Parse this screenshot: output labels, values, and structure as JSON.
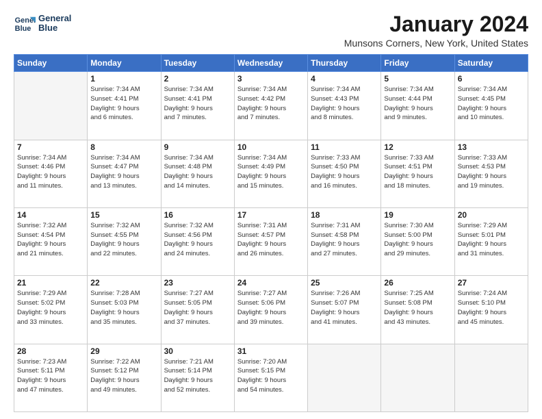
{
  "header": {
    "logo_line1": "General",
    "logo_line2": "Blue",
    "month_title": "January 2024",
    "location": "Munsons Corners, New York, United States"
  },
  "days_of_week": [
    "Sunday",
    "Monday",
    "Tuesday",
    "Wednesday",
    "Thursday",
    "Friday",
    "Saturday"
  ],
  "weeks": [
    [
      {
        "day": "",
        "empty": true
      },
      {
        "day": "1",
        "sunrise": "7:34 AM",
        "sunset": "4:41 PM",
        "daylight": "9 hours and 6 minutes."
      },
      {
        "day": "2",
        "sunrise": "7:34 AM",
        "sunset": "4:41 PM",
        "daylight": "9 hours and 7 minutes."
      },
      {
        "day": "3",
        "sunrise": "7:34 AM",
        "sunset": "4:42 PM",
        "daylight": "9 hours and 7 minutes."
      },
      {
        "day": "4",
        "sunrise": "7:34 AM",
        "sunset": "4:43 PM",
        "daylight": "9 hours and 8 minutes."
      },
      {
        "day": "5",
        "sunrise": "7:34 AM",
        "sunset": "4:44 PM",
        "daylight": "9 hours and 9 minutes."
      },
      {
        "day": "6",
        "sunrise": "7:34 AM",
        "sunset": "4:45 PM",
        "daylight": "9 hours and 10 minutes."
      }
    ],
    [
      {
        "day": "7",
        "sunrise": "7:34 AM",
        "sunset": "4:46 PM",
        "daylight": "9 hours and 11 minutes."
      },
      {
        "day": "8",
        "sunrise": "7:34 AM",
        "sunset": "4:47 PM",
        "daylight": "9 hours and 13 minutes."
      },
      {
        "day": "9",
        "sunrise": "7:34 AM",
        "sunset": "4:48 PM",
        "daylight": "9 hours and 14 minutes."
      },
      {
        "day": "10",
        "sunrise": "7:34 AM",
        "sunset": "4:49 PM",
        "daylight": "9 hours and 15 minutes."
      },
      {
        "day": "11",
        "sunrise": "7:33 AM",
        "sunset": "4:50 PM",
        "daylight": "9 hours and 16 minutes."
      },
      {
        "day": "12",
        "sunrise": "7:33 AM",
        "sunset": "4:51 PM",
        "daylight": "9 hours and 18 minutes."
      },
      {
        "day": "13",
        "sunrise": "7:33 AM",
        "sunset": "4:53 PM",
        "daylight": "9 hours and 19 minutes."
      }
    ],
    [
      {
        "day": "14",
        "sunrise": "7:32 AM",
        "sunset": "4:54 PM",
        "daylight": "9 hours and 21 minutes."
      },
      {
        "day": "15",
        "sunrise": "7:32 AM",
        "sunset": "4:55 PM",
        "daylight": "9 hours and 22 minutes."
      },
      {
        "day": "16",
        "sunrise": "7:32 AM",
        "sunset": "4:56 PM",
        "daylight": "9 hours and 24 minutes."
      },
      {
        "day": "17",
        "sunrise": "7:31 AM",
        "sunset": "4:57 PM",
        "daylight": "9 hours and 26 minutes."
      },
      {
        "day": "18",
        "sunrise": "7:31 AM",
        "sunset": "4:58 PM",
        "daylight": "9 hours and 27 minutes."
      },
      {
        "day": "19",
        "sunrise": "7:30 AM",
        "sunset": "5:00 PM",
        "daylight": "9 hours and 29 minutes."
      },
      {
        "day": "20",
        "sunrise": "7:29 AM",
        "sunset": "5:01 PM",
        "daylight": "9 hours and 31 minutes."
      }
    ],
    [
      {
        "day": "21",
        "sunrise": "7:29 AM",
        "sunset": "5:02 PM",
        "daylight": "9 hours and 33 minutes."
      },
      {
        "day": "22",
        "sunrise": "7:28 AM",
        "sunset": "5:03 PM",
        "daylight": "9 hours and 35 minutes."
      },
      {
        "day": "23",
        "sunrise": "7:27 AM",
        "sunset": "5:05 PM",
        "daylight": "9 hours and 37 minutes."
      },
      {
        "day": "24",
        "sunrise": "7:27 AM",
        "sunset": "5:06 PM",
        "daylight": "9 hours and 39 minutes."
      },
      {
        "day": "25",
        "sunrise": "7:26 AM",
        "sunset": "5:07 PM",
        "daylight": "9 hours and 41 minutes."
      },
      {
        "day": "26",
        "sunrise": "7:25 AM",
        "sunset": "5:08 PM",
        "daylight": "9 hours and 43 minutes."
      },
      {
        "day": "27",
        "sunrise": "7:24 AM",
        "sunset": "5:10 PM",
        "daylight": "9 hours and 45 minutes."
      }
    ],
    [
      {
        "day": "28",
        "sunrise": "7:23 AM",
        "sunset": "5:11 PM",
        "daylight": "9 hours and 47 minutes."
      },
      {
        "day": "29",
        "sunrise": "7:22 AM",
        "sunset": "5:12 PM",
        "daylight": "9 hours and 49 minutes."
      },
      {
        "day": "30",
        "sunrise": "7:21 AM",
        "sunset": "5:14 PM",
        "daylight": "9 hours and 52 minutes."
      },
      {
        "day": "31",
        "sunrise": "7:20 AM",
        "sunset": "5:15 PM",
        "daylight": "9 hours and 54 minutes."
      },
      {
        "day": "",
        "empty": true
      },
      {
        "day": "",
        "empty": true
      },
      {
        "day": "",
        "empty": true
      }
    ]
  ],
  "labels": {
    "sunrise_prefix": "Sunrise: ",
    "sunset_prefix": "Sunset: ",
    "daylight_prefix": "Daylight: "
  }
}
